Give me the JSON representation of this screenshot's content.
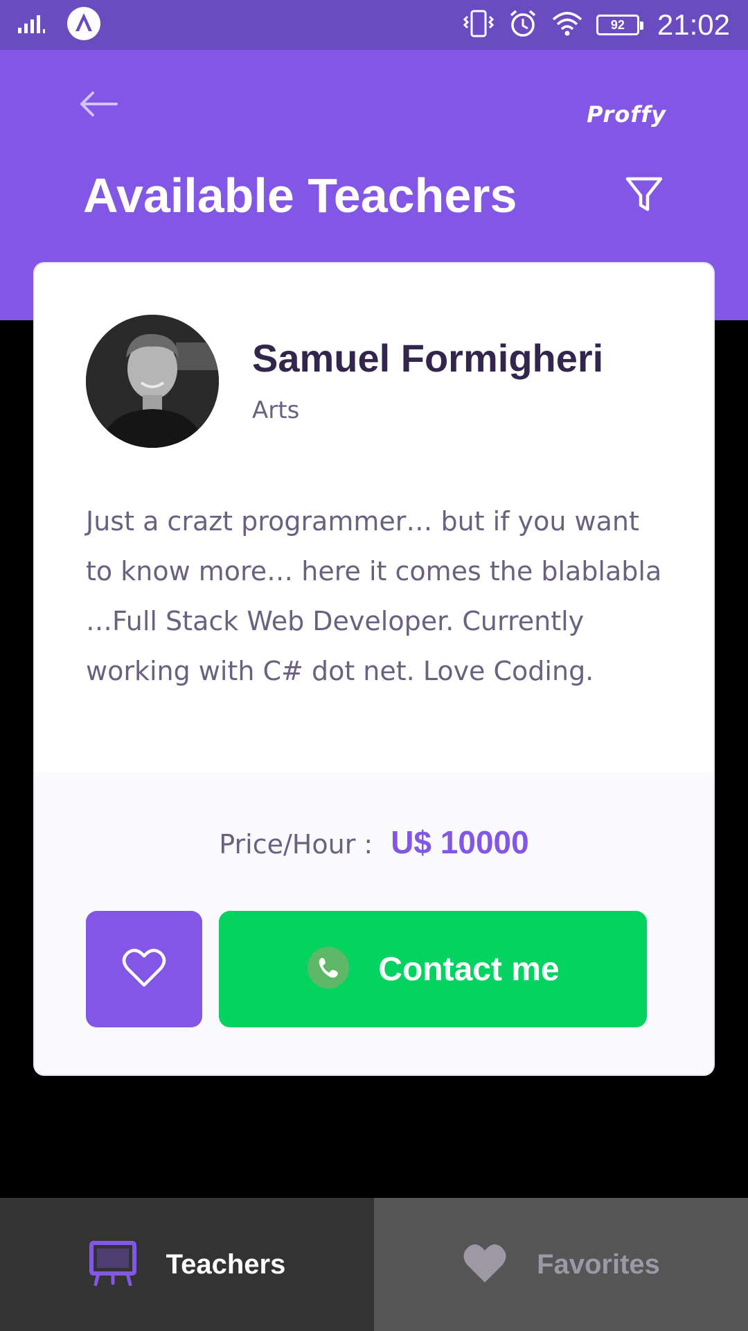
{
  "status_bar": {
    "battery": "92",
    "time": "21:02"
  },
  "header": {
    "brand": "Proffy",
    "title": "Available Teachers"
  },
  "teacher": {
    "name": "Samuel Formigheri",
    "subject": "Arts",
    "bio": "Just a crazt programmer… but if you want to know more… here it comes the blablabla …Full Stack Web Developer. Currently working with C# dot net. Love Coding.",
    "price_label": "Price/Hour :",
    "price_value": "U$ 10000",
    "contact_label": "Contact me"
  },
  "tabs": [
    {
      "label": "Teachers",
      "active": true
    },
    {
      "label": "Favorites",
      "active": false
    }
  ],
  "colors": {
    "primary": "#8257E5",
    "status_bar": "#6A4BC0",
    "contact_green": "#04D361",
    "title_dark": "#32264D",
    "text_body": "#6A6180"
  }
}
